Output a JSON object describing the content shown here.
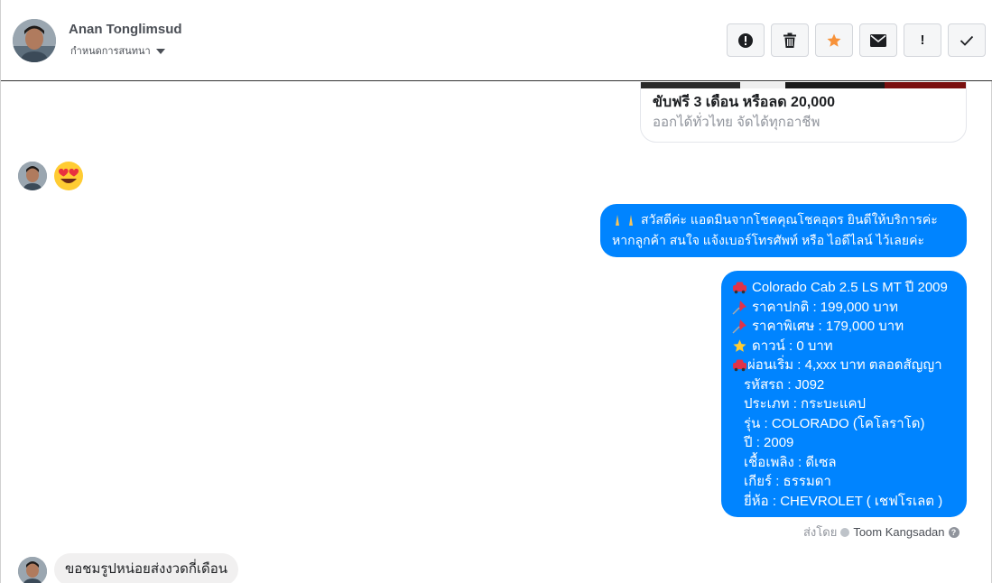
{
  "header": {
    "contact_name": "Anan Tonglimsud",
    "assign_label": "กำหนดการสนทนา",
    "toolbar": {
      "spam_icon": "alert-circle-icon",
      "delete_icon": "trash-icon",
      "star_icon": "star-icon",
      "unread_icon": "envelope-icon",
      "important_icon": "exclamation-icon",
      "done_icon": "check-icon",
      "important_label": "!"
    }
  },
  "ad_card": {
    "title": "ขับฟรี 3 เดือน หรือลด 20,000",
    "subtitle": "ออกได้ทั่วไทย จัดได้ทุกอาชีพ"
  },
  "messages": {
    "reaction_emoji": "heart-eyes-emoji",
    "greeting": {
      "line1": "สวัสดีค่ะ แอดมินจากโชคคุณโชคอุดร ยินดีให้บริการค่ะ",
      "line2": "หากลูกค้า สนใจ แจ้งเบอร์โทรศัพท์ หรือ ไอดีไลน์  ไว้เลยค่ะ"
    },
    "car_details": {
      "model_line": "Colorado Cab 2.5 LS MT ปี 2009",
      "normal_price": "ราคาปกติ : 199,000 บาท",
      "special_price": "ราคาพิเศษ : 179,000 บาท",
      "down_payment": "ดาวน์ : 0 บาท",
      "installment": "ผ่อนเริ่ม : 4,xxx บาท ตลอดสัญญา",
      "car_code": "รหัสรถ : J092",
      "car_type": "ประเภท : กระบะแคป",
      "car_model": "รุ่น : COLORADO (โคโลราโด)",
      "year": "ปี : 2009",
      "fuel": "เชื้อเพลิง : ดีเซล",
      "gear": "เกียร์ : ธรรมดา",
      "brand": "ยี่ห้อ : CHEVROLET ( เชฟโรเลต )"
    },
    "sent_by_label": "ส่งโดย",
    "sent_by_name": "Toom Kangsadan",
    "incoming_question": "ขอชมรูปหน่อยส่งงวดกี่เดือน"
  },
  "colors": {
    "outgoing_bubble": "#0084ff",
    "incoming_bubble": "#f1f0f0",
    "star_active": "#f7923a"
  }
}
